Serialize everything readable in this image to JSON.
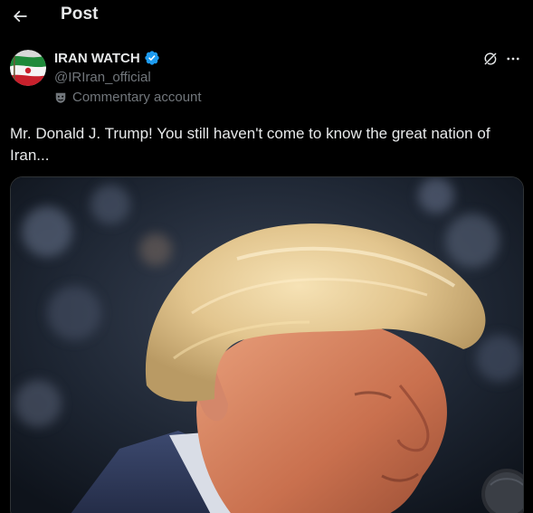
{
  "header": {
    "title": "Post",
    "back_icon": "arrow-left-icon"
  },
  "author": {
    "name": "IRAN WATCH",
    "handle": "@IRIran_official",
    "verified": true,
    "verified_color": "#1d9bf0",
    "label": "Commentary account",
    "label_icon": "theater-mask-icon",
    "avatar_icon": "iran-flag-avatar"
  },
  "actions": {
    "grok_icon": "grok-icon",
    "more_icon": "more-horizontal-icon"
  },
  "post": {
    "text": "Mr. Donald J. Trump! You still haven't come to know the great nation of Iran..."
  },
  "media": {
    "kind": "photo"
  },
  "colors": {
    "background": "#000000",
    "text_primary": "#e7e9ea",
    "text_secondary": "#71767b",
    "accent": "#1d9bf0",
    "border": "#2f3336"
  }
}
